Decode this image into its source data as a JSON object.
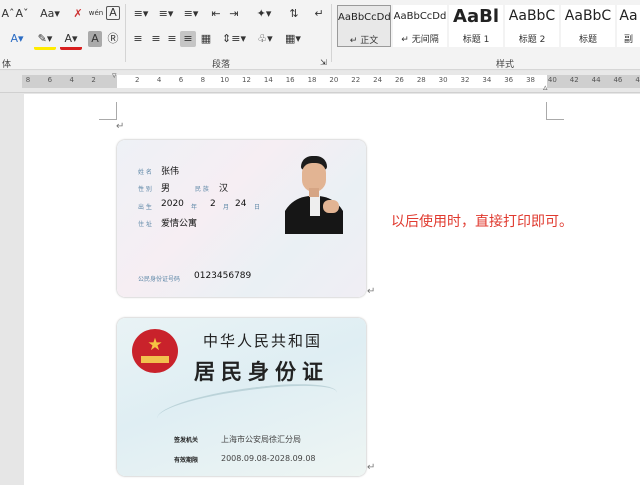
{
  "ribbon": {
    "row1_left": [
      "Aˆ",
      "Aˇ",
      "Aa▾"
    ],
    "phonetic_icon": "wén",
    "char_border": "A",
    "paragraph_group": "段落",
    "font_group": "体",
    "styles_group": "样式",
    "styles": [
      {
        "preview": "AaBbCcDd",
        "name": "↵ 正文",
        "active": true
      },
      {
        "preview": "AaBbCcDd",
        "name": "↵ 无间隔"
      },
      {
        "preview": "AaBl",
        "name": "标题 1",
        "big": true
      },
      {
        "preview": "AaBbC",
        "name": "标题 2"
      },
      {
        "preview": "AaBbC",
        "name": "标题"
      },
      {
        "preview": "Aa",
        "name": "副"
      }
    ]
  },
  "ruler": {
    "ticks": [
      "8",
      "6",
      "4",
      "2",
      "",
      "2",
      "4",
      "6",
      "8",
      "10",
      "12",
      "14",
      "16",
      "18",
      "20",
      "22",
      "24",
      "26",
      "28",
      "30",
      "32",
      "34",
      "36",
      "38",
      "40",
      "42",
      "44",
      "46",
      "48"
    ]
  },
  "document": {
    "note": "以后使用时，直接打印即可。",
    "front": {
      "name_label": "姓 名",
      "name": "张伟",
      "sex_label": "性 别",
      "sex": "男",
      "nation_label": "民 族",
      "nation": "汉",
      "birth_label": "出 生",
      "year": "2020",
      "year_unit": "年",
      "month": "2",
      "month_unit": "月",
      "day": "24",
      "day_unit": "日",
      "addr_label": "住 址",
      "addr": "爱情公寓",
      "id_label": "公民身份证号码",
      "id": "0123456789"
    },
    "back": {
      "title1": "中华人民共和国",
      "title2": "居民身份证",
      "authority_label": "签发机关",
      "authority": "上海市公安局徐汇分局",
      "validity_label": "有效期限",
      "validity": "2008.09.08-2028.09.08"
    }
  },
  "colors": {
    "accent_red": "#e03a2f",
    "card_label": "#5c86a6"
  }
}
